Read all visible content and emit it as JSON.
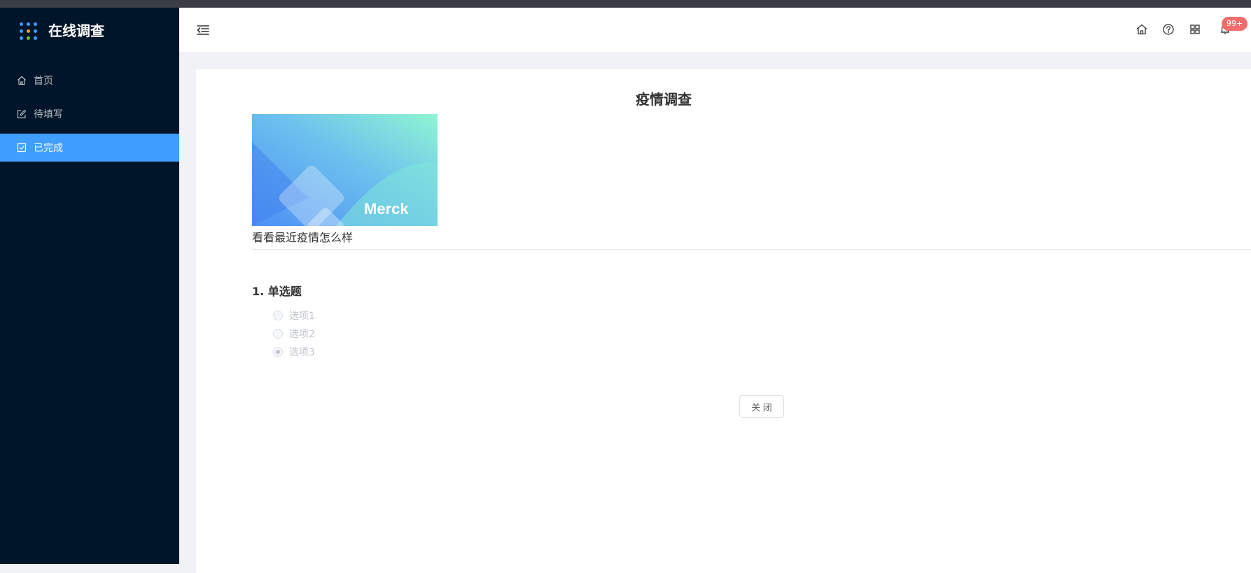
{
  "app": {
    "title": "在线调查"
  },
  "sidebar": {
    "items": [
      {
        "label": "首页",
        "icon": "home-icon",
        "active": false
      },
      {
        "label": "待填写",
        "icon": "edit-icon",
        "active": false
      },
      {
        "label": "已完成",
        "icon": "checkbox-icon",
        "active": true
      }
    ]
  },
  "header": {
    "notification_badge": "99+"
  },
  "survey": {
    "title": "疫情调查",
    "banner_logo_text": "Merck",
    "description": "看看最近疫情怎么样",
    "question": {
      "title": "1. 单选题",
      "options": [
        {
          "label": "选项1",
          "checked": false
        },
        {
          "label": "选项2",
          "checked": false
        },
        {
          "label": "选项3",
          "checked": true
        }
      ]
    },
    "close_label": "关 闭"
  },
  "colors": {
    "sidebar_bg": "#001529",
    "active": "#409eff",
    "badge": "#f56c6c"
  }
}
